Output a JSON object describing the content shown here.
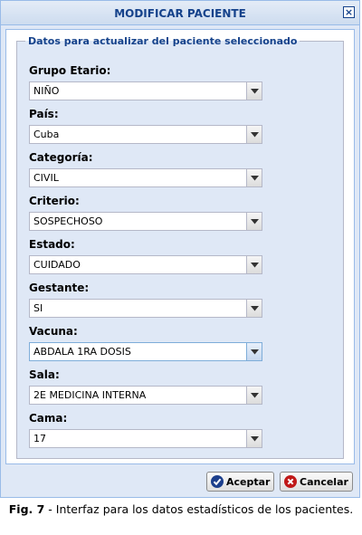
{
  "dialog": {
    "title": "MODIFICAR PACIENTE",
    "legend": "Datos para actualizar del paciente seleccionado",
    "fields": [
      {
        "label": "Grupo Etario:",
        "value": "NIÑO"
      },
      {
        "label": "País:",
        "value": "Cuba"
      },
      {
        "label": "Categoría:",
        "value": "CIVIL"
      },
      {
        "label": "Criterio:",
        "value": "SOSPECHOSO"
      },
      {
        "label": "Estado:",
        "value": "CUIDADO"
      },
      {
        "label": "Gestante:",
        "value": "SI"
      },
      {
        "label": "Vacuna:",
        "value": "ABDALA 1RA DOSIS"
      },
      {
        "label": "Sala:",
        "value": "2E MEDICINA INTERNA"
      },
      {
        "label": "Cama:",
        "value": "17"
      }
    ],
    "accept_label": "Aceptar",
    "cancel_label": "Cancelar",
    "colors": {
      "accept_icon": "#1c3f8c",
      "cancel_icon": "#c01818",
      "title_text": "#15428b"
    }
  },
  "caption": {
    "prefix": "Fig. 7",
    "text": " - Interfaz para los datos estadísticos de los pacientes."
  }
}
